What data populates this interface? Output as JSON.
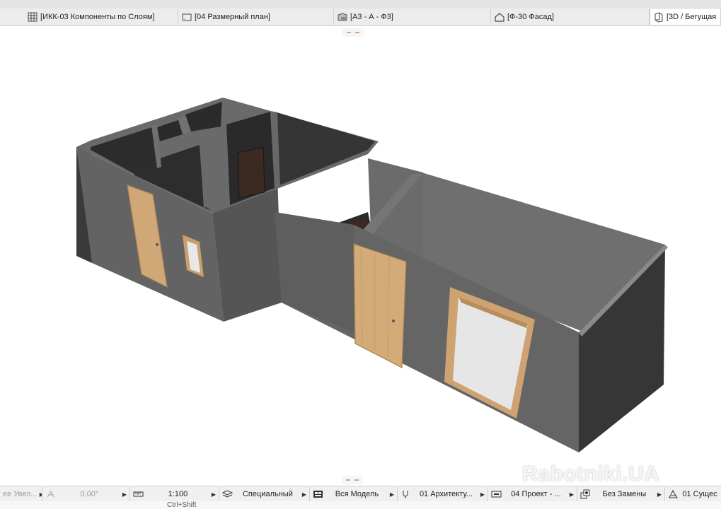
{
  "tabs": [
    {
      "label": "[ИКК-03 Компоненты по Слоям]",
      "icon": "schedule-grid-icon"
    },
    {
      "label": "[04 Размерный план]",
      "icon": "floor-plan-icon"
    },
    {
      "label": "[А3 - А - Ф3]",
      "icon": "section-icon"
    },
    {
      "label": "[Ф-30 Фасад]",
      "icon": "elevation-house-icon"
    },
    {
      "label": "[3D / Бегущая",
      "icon": "3d-view-icon"
    }
  ],
  "pin_label": "----",
  "watermark": "Rabotniki.UA",
  "statusbar": {
    "zoom": "ее Увел...",
    "angle": "0,00°",
    "scale": "1:100",
    "layer_combo": "Специальный",
    "model_view": "Вся Модель",
    "pen_set": "01 Архитекту...",
    "dimension": "04 Проект - ...",
    "override": "Без Замены",
    "renovation": "01 Сущес"
  },
  "hint_text": "Ctrl+Shift",
  "colors": {
    "wall_top": "#6e6e6e",
    "wall_front": "#646464",
    "wall_side": "#3f3f3f",
    "interior": "#2a2a2a",
    "door_light": "#d2a877",
    "door_dark": "#3a2a22",
    "glass": "#e6e6e6"
  }
}
